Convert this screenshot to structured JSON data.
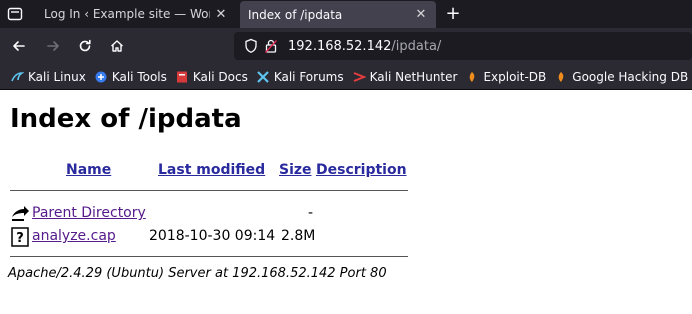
{
  "browser": {
    "tabs": [
      {
        "title": "Log In ‹ Example site — Word",
        "active": false
      },
      {
        "title": "Index of /ipdata",
        "active": true
      }
    ],
    "url": {
      "host": "192.168.52.142",
      "path": "/ipdata/"
    },
    "bookmarks": [
      {
        "label": "Kali Linux",
        "icon": "kali-dragon-icon"
      },
      {
        "label": "Kali Tools",
        "icon": "kali-tools-icon"
      },
      {
        "label": "Kali Docs",
        "icon": "kali-docs-icon"
      },
      {
        "label": "Kali Forums",
        "icon": "kali-forums-icon"
      },
      {
        "label": "Kali NetHunter",
        "icon": "kali-nethunter-icon"
      },
      {
        "label": "Exploit-DB",
        "icon": "exploit-db-icon"
      },
      {
        "label": "Google Hacking DB",
        "icon": "google-hacking-db-icon"
      }
    ]
  },
  "page": {
    "title": "Index of /ipdata",
    "columns": {
      "name": "Name",
      "modified": "Last modified",
      "size": "Size",
      "description": "Description"
    },
    "rows": [
      {
        "name": "Parent Directory",
        "modified": "",
        "size": "-",
        "icon": "back-icon"
      },
      {
        "name": "analyze.cap",
        "modified": "2018-10-30 09:14",
        "size": "2.8M",
        "icon": "unknown-file-icon"
      }
    ],
    "address": "Apache/2.4.29 (Ubuntu) Server at 192.168.52.142 Port 80"
  }
}
